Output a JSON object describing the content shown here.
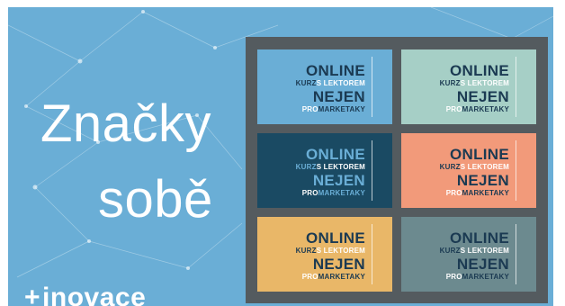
{
  "title": {
    "line1": "Značky",
    "line2": "sobě"
  },
  "logo": {
    "plus": "+",
    "text": "inovace"
  },
  "cards": [
    {
      "bg": "#6aaed6",
      "dark": "#1b3a52",
      "online": "ONLINE",
      "kurz": "KURZ",
      "s_lektorem": "S LEKTOREM",
      "nejen": "NEJEN",
      "pro": "PRO",
      "marketaky": "MARKETAKY"
    },
    {
      "bg": "#a6cfc6",
      "dark": "#1b3a52",
      "online": "ONLINE",
      "kurz": "KURZ",
      "s_lektorem": "S LEKTOREM",
      "nejen": "NEJEN",
      "pro": "PRO",
      "marketaky": "MARKETAKY"
    },
    {
      "bg": "#1a4a63",
      "dark": "#6aaed6",
      "online": "ONLINE",
      "kurz": "KURZ",
      "s_lektorem": "S LEKTOREM",
      "nejen": "NEJEN",
      "pro": "PRO",
      "marketaky": "MARKETAKY"
    },
    {
      "bg": "#f29a7a",
      "dark": "#1b3a52",
      "online": "ONLINE",
      "kurz": "KURZ",
      "s_lektorem": "S LEKTOREM",
      "nejen": "NEJEN",
      "pro": "PRO",
      "marketaky": "MARKETAKY"
    },
    {
      "bg": "#e9b768",
      "dark": "#1b3a52",
      "online": "ONLINE",
      "kurz": "KURZ",
      "s_lektorem": "S LEKTOREM",
      "nejen": "NEJEN",
      "pro": "PRO",
      "marketaky": "MARKETAKY"
    },
    {
      "bg": "#6c8a8f",
      "dark": "#1b3a52",
      "online": "ONLINE",
      "kurz": "KURZ",
      "s_lektorem": "S LEKTOREM",
      "nejen": "NEJEN",
      "pro": "PRO",
      "marketaky": "MARKETAKY"
    }
  ]
}
